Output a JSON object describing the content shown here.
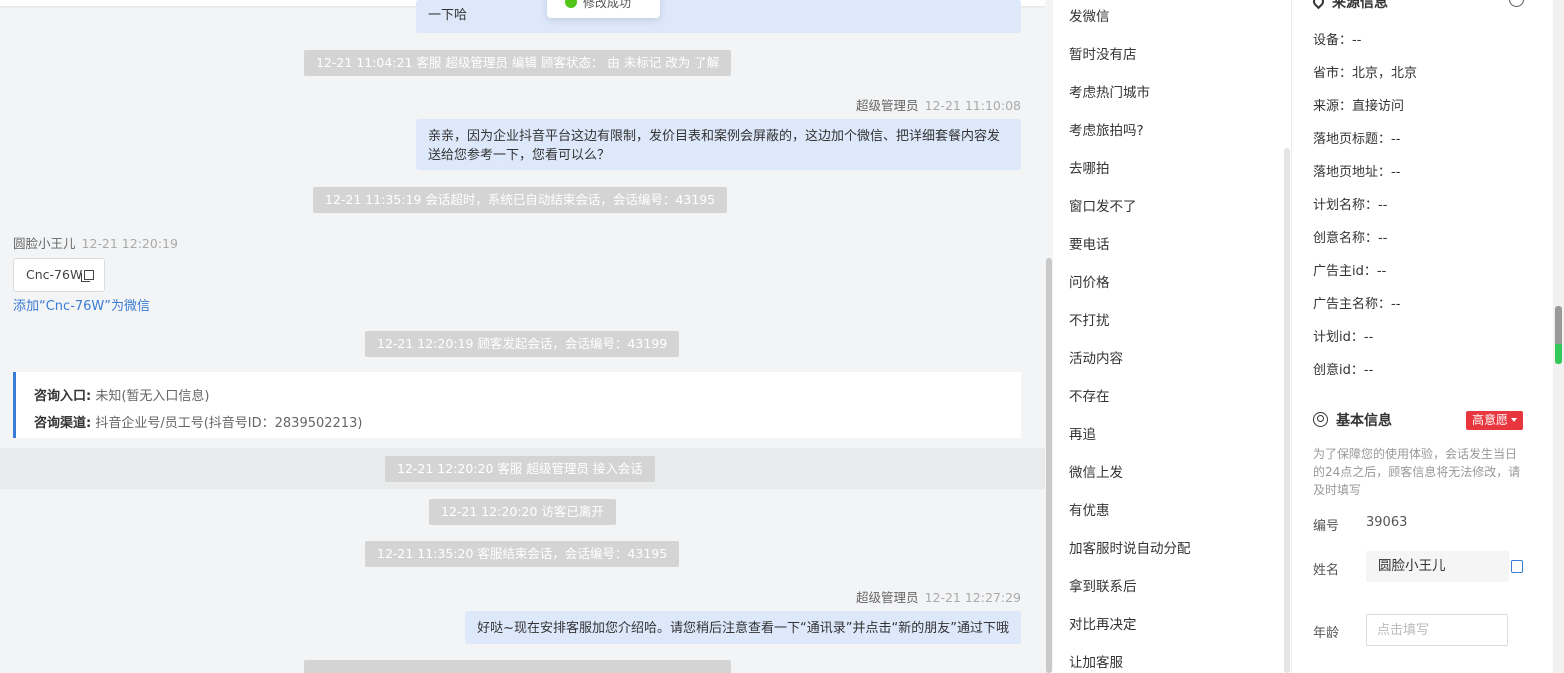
{
  "chat": {
    "toast": "修改成功",
    "bubble_top": "一下哈",
    "sys1": "12-21 11:04:21 客服 超级管理员 编辑 顾客状态： 由 未标记 改为 了解",
    "msg1": {
      "sender": "超级管理员",
      "time": "12-21 11:10:08",
      "text": "亲亲，因为企业抖音平台这边有限制，发价目表和案例会屏蔽的，这边加个微信、把详细套餐内容发送给您参考一下，您看可以么？"
    },
    "sys2": "12-21 11:35:19 会话超时，系统已自动结束会话，会话编号：43195",
    "customer": {
      "name": "圆脸小王儿",
      "time": "12-21 12:20:19"
    },
    "wechat_card": "Cnc-76W",
    "add_wechat": "添加“Cnc-76W”为微信",
    "sys3": "12-21 12:20:19 顾客发起会话，会话编号：43199",
    "entry": {
      "label1": "咨询入口:",
      "value1": "未知(暂无入口信息)",
      "label2": "咨询渠道:",
      "value2": "抖音企业号/员工号(抖音号ID：2839502213)"
    },
    "sys4": "12-21 12:20:20 客服 超级管理员 接入会话",
    "sys5": "12-21 12:20:20 访客已离开",
    "sys6": "12-21 11:35:20 客服结束会话，会话编号：43195",
    "msg2": {
      "sender": "超级管理员",
      "time": "12-21 12:27:29",
      "text": "好哒~现在安排客服加您介绍哈。请您稍后注意查看一下“通讯录”并点击“新的朋友”通过下哦"
    }
  },
  "quick_replies": [
    "发微信",
    "暂时没有店",
    "考虑热门城市",
    "考虑旅拍吗?",
    "去哪拍",
    "窗口发不了",
    "要电话",
    "问价格",
    "不打扰",
    "活动内容",
    "不存在",
    "再追",
    "微信上发",
    "有优惠",
    "加客服时说自动分配",
    "拿到联系后",
    "对比再决定",
    "让加客服"
  ],
  "source_info": {
    "title": "来源信息",
    "rows": [
      {
        "label": "设备：",
        "value": "--"
      },
      {
        "label": "省市：",
        "value": "北京，北京"
      },
      {
        "label": "来源：",
        "value": "直接访问"
      },
      {
        "label": "落地页标题：",
        "value": "--"
      },
      {
        "label": "落地页地址：",
        "value": "--"
      },
      {
        "label": "计划名称：",
        "value": "--"
      },
      {
        "label": "创意名称：",
        "value": "--"
      },
      {
        "label": "广告主id：",
        "value": "--"
      },
      {
        "label": "广告主名称：",
        "value": "--"
      },
      {
        "label": "计划id：",
        "value": "--"
      },
      {
        "label": "创意id：",
        "value": "--"
      }
    ]
  },
  "basic_info": {
    "title": "基本信息",
    "intent": "高意愿",
    "notice": "为了保障您的使用体验，会话发生当日的24点之后，顾客信息将无法修改，请及时填写",
    "id_label": "编号",
    "id_value": "39063",
    "name_label": "姓名",
    "name_value": "圆脸小王儿",
    "age_label": "年龄",
    "age_placeholder": "点击填写"
  },
  "colors": {
    "accent": "#3a7bd5",
    "bubble": "#dde8fb",
    "system": "#d4d4d4",
    "badge": "#e8363e"
  }
}
